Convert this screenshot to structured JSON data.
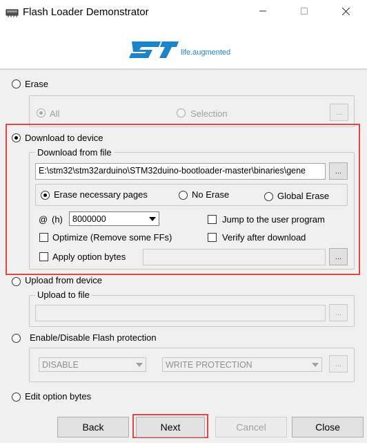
{
  "window": {
    "title": "Flash Loader Demonstrator",
    "controls": [
      "minimize-icon",
      "maximize-icon",
      "close-icon"
    ]
  },
  "logo": {
    "brand_icon": "st-logo",
    "tagline": "life.augmented",
    "brand_color": "#1f84c6"
  },
  "erase": {
    "label": "Erase",
    "selected": false,
    "options": {
      "all": "All",
      "selection": "Selection"
    },
    "browse_label": "..."
  },
  "download": {
    "label": "Download to device",
    "selected": true,
    "file_group_title": "Download from file",
    "file_path": "E:\\stm32\\stm32arduino\\STM32duino-bootloader-master\\binaries\\gene",
    "browse_label": "...",
    "erase_modes": {
      "necessary": "Erase necessary pages",
      "none": "No Erase",
      "global": "Global Erase"
    },
    "erase_mode_selected": "necessary",
    "address_prefix": "@",
    "address_unit": "(h)",
    "address_value": "8000000",
    "jump_label": "Jump to the user program",
    "optimize_label": "Optimize (Remove some FFs)",
    "verify_label": "Verify after download",
    "apply_option_label": "Apply option bytes",
    "apply_browse_label": "...",
    "highlight_color": "#e64343"
  },
  "upload": {
    "label": "Upload from device",
    "file_group_title": "Upload to file",
    "browse_label": "..."
  },
  "protection": {
    "label": "Enable/Disable Flash protection",
    "state_value": "DISABLE",
    "type_value": "WRITE PROTECTION",
    "browse_label": "..."
  },
  "edit_option": {
    "label": "Edit option bytes"
  },
  "buttons": {
    "back": "Back",
    "next": "Next",
    "cancel": "Cancel",
    "close": "Close"
  }
}
